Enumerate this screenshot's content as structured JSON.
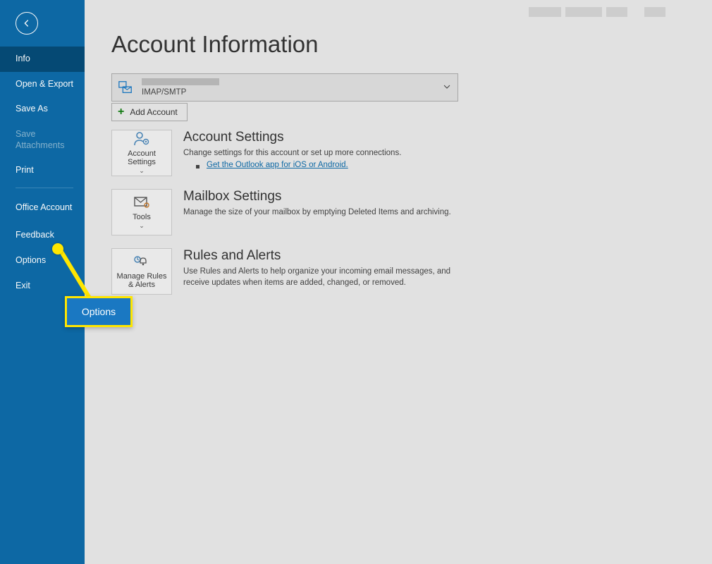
{
  "sidebar": {
    "items": [
      {
        "label": "Info"
      },
      {
        "label": "Open & Export"
      },
      {
        "label": "Save As"
      },
      {
        "label": "Save Attachments"
      },
      {
        "label": "Print"
      },
      {
        "label": "Office Account"
      },
      {
        "label": "Feedback"
      },
      {
        "label": "Options"
      },
      {
        "label": "Exit"
      }
    ]
  },
  "page": {
    "title": "Account Information",
    "account_type": "IMAP/SMTP",
    "add_account_label": "Add Account"
  },
  "sections": {
    "account_settings": {
      "tile_label": "Account Settings",
      "title": "Account Settings",
      "desc": "Change settings for this account or set up more connections.",
      "link": "Get the Outlook app for iOS or Android."
    },
    "mailbox": {
      "tile_label": "Tools",
      "title": "Mailbox Settings",
      "desc": "Manage the size of your mailbox by emptying Deleted Items and archiving."
    },
    "rules": {
      "tile_label": "Manage Rules & Alerts",
      "title": "Rules and Alerts",
      "desc": "Use Rules and Alerts to help organize your incoming email messages, and receive updates when items are added, changed, or removed."
    }
  },
  "annotation": {
    "label": "Options"
  }
}
